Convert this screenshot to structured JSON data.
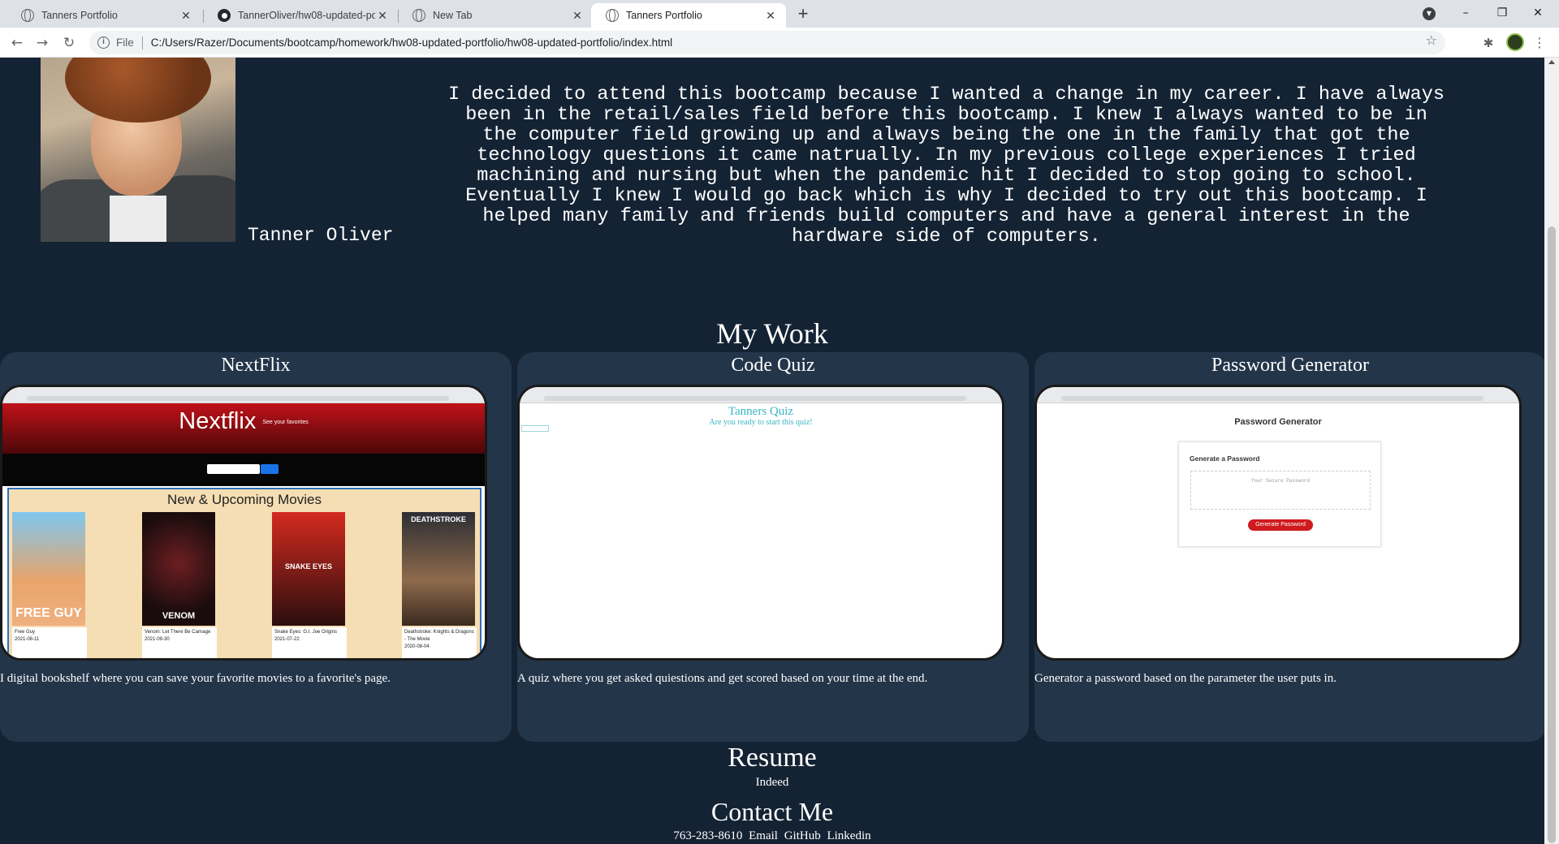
{
  "browser": {
    "tabs": [
      {
        "title": "Tanners Portfolio",
        "active": false
      },
      {
        "title": "TannerOliver/hw08-updated-portfolio",
        "active": false
      },
      {
        "title": "New Tab",
        "active": false
      },
      {
        "title": "Tanners Portfolio",
        "active": true
      }
    ],
    "address_scheme": "File",
    "address_url": "C:/Users/Razer/Documents/bootcamp/homework/hw08-updated-portfolio/hw08-updated-portfolio/index.html"
  },
  "profile": {
    "name": "Tanner Oliver",
    "bio": "I decided to attend this bootcamp because I wanted a change in my career. I have always been in the retail/sales field before this bootcamp. I knew I always wanted to be in the computer field growing up and always being the one in the family that got the technology questions it came natrually. In my previous college experiences I tried machining and nursing but when the pandemic hit I decided to stop going to school. Eventually I knew I would go back which is why I decided to try out this bootcamp. I helped many family and friends build computers and have a general interest in the hardware side of computers."
  },
  "work": {
    "heading": "My Work",
    "projects": [
      {
        "title": "NextFlix",
        "description": "I digital bookshelf where you can save your favorite movies to a favorite's page.",
        "preview": {
          "logo": "Nextflix",
          "tagline": "See your favorites",
          "panel_title": "New & Upcoming Movies",
          "posters": [
            {
              "art_text": "FREE GUY",
              "caption": "Free Guy",
              "date": "2021-08-11"
            },
            {
              "art_text": "VENOM",
              "caption": "Venom: Let There Be Carnage",
              "date": "2021-09-30"
            },
            {
              "art_text": "SNAKE EYES",
              "caption": "Snake Eyes: G.I. Joe Origins",
              "date": "2021-07-22"
            },
            {
              "art_text": "DEATHSTROKE",
              "caption": "Deathstroke: Knights & Dragons - The Movie",
              "date": "2020-08-04"
            }
          ]
        }
      },
      {
        "title": "Code Quiz",
        "description": "A quiz where you get asked quiestions and get scored based on your time at the end.",
        "preview": {
          "title": "Tanners Quiz",
          "subtitle": "Are you ready to start this quiz!"
        }
      },
      {
        "title": "Password Generator",
        "description": "Generator a password based on the parameter the user puts in.",
        "preview": {
          "title": "Password Generator",
          "card_title": "Generate a Password",
          "placeholder": "Your Secure Password",
          "button": "Generate Password"
        }
      }
    ]
  },
  "resume": {
    "heading": "Resume",
    "link": "Indeed"
  },
  "contact": {
    "heading": "Contact Me",
    "phone": "763-283-8610",
    "links": [
      "Email",
      "GitHub",
      "Linkedin"
    ]
  }
}
